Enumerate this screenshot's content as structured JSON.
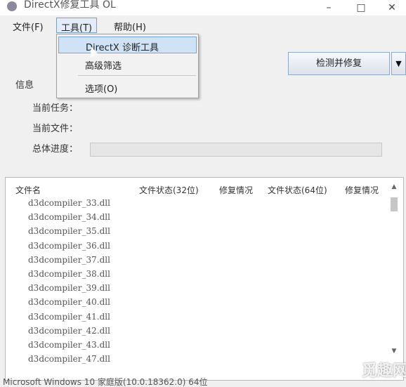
{
  "window": {
    "title": "DirectX修复工具 OL",
    "minimize": "–",
    "maximize": "□",
    "close": "✕"
  },
  "menu": {
    "file": "文件(F)",
    "tools": "工具(T)",
    "help": "帮助(H)"
  },
  "tools_menu": {
    "items": [
      "DirectX 诊断工具",
      "高级筛选",
      "选项(O)"
    ]
  },
  "actions": {
    "primary": "检测并修复",
    "split_arrow": "▼"
  },
  "info": {
    "section_label": "信息",
    "task_label": "当前任务：",
    "file_label": "当前文件：",
    "progress_label": "总体进度：",
    "progress_value": 0
  },
  "file_list": {
    "columns": [
      "文件名",
      "文件状态(32位)",
      "修复情况",
      "文件状态(64位)",
      "修复情况"
    ],
    "rows": [
      "d3dcompiler_33.dll",
      "d3dcompiler_34.dll",
      "d3dcompiler_35.dll",
      "d3dcompiler_36.dll",
      "d3dcompiler_37.dll",
      "d3dcompiler_38.dll",
      "d3dcompiler_39.dll",
      "d3dcompiler_40.dll",
      "d3dcompiler_41.dll",
      "d3dcompiler_42.dll",
      "d3dcompiler_43.dll",
      "d3dcompiler_47.dll"
    ]
  },
  "status": {
    "os_text": "Microsoft Windows 10 家庭版(10.0.18362.0) 64位"
  },
  "watermark": "觅趣网",
  "icons": {
    "app": "directx-app-icon",
    "cursor": "mouse-pointer-icon",
    "scroll_up": "chevron-up-icon",
    "scroll_down": "chevron-down-icon"
  },
  "colors": {
    "menu_highlight": "#cfe2f6",
    "menu_highlight_border": "#7aa5d8",
    "button_border": "#8fa8c8",
    "progress_fill": "#3aa04a"
  }
}
